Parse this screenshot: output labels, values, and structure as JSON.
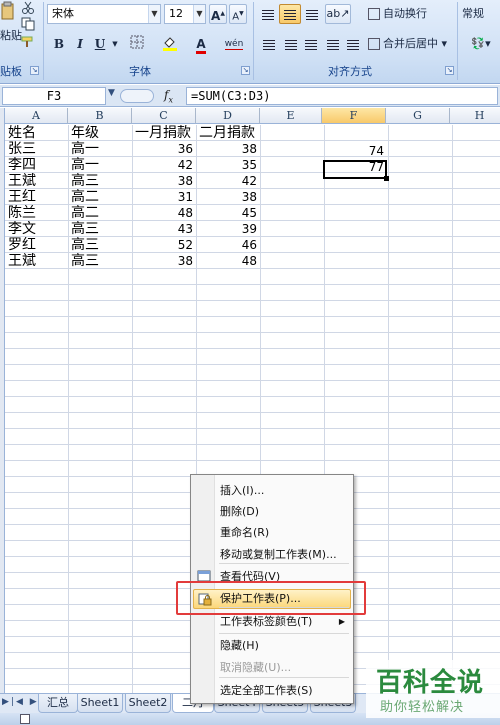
{
  "ribbon": {
    "paste_label": "粘贴",
    "clipboard_label": "贴板",
    "font_name": "宋体",
    "font_size": "12",
    "bold": "B",
    "italic": "I",
    "underline": "U",
    "font_group_label": "字体",
    "wrap_text": "自动换行",
    "merge_center": "合并后居中",
    "align_group_label": "对齐方式",
    "number_format": "常规",
    "grow_font": "A",
    "shrink_font": "A",
    "font_color_letter": "A",
    "phonetic_label": "wén"
  },
  "formula_bar": {
    "name_box": "F3",
    "fx": "f",
    "formula": "=SUM(C3:D3)"
  },
  "columns": [
    "A",
    "B",
    "C",
    "D",
    "E",
    "F",
    "G",
    "H"
  ],
  "table": {
    "headers": [
      "姓名",
      "年级",
      "一月捐款",
      "二月捐款"
    ],
    "rows": [
      [
        "张三",
        "高一",
        "36",
        "38"
      ],
      [
        "李四",
        "高一",
        "42",
        "35"
      ],
      [
        "王斌",
        "高三",
        "38",
        "42"
      ],
      [
        "王红",
        "高二",
        "31",
        "38"
      ],
      [
        "陈兰",
        "高二",
        "48",
        "45"
      ],
      [
        "李文",
        "高三",
        "43",
        "39"
      ],
      [
        "罗红",
        "高三",
        "52",
        "46"
      ],
      [
        "王斌",
        "高三",
        "38",
        "48"
      ]
    ],
    "f_values": [
      "74",
      "77"
    ]
  },
  "context_menu": {
    "items": [
      "插入(I)...",
      "删除(D)",
      "重命名(R)",
      "移动或复制工作表(M)...",
      "查看代码(V)",
      "保护工作表(P)...",
      "工作表标签颜色(T)",
      "隐藏(H)",
      "取消隐藏(U)...",
      "选定全部工作表(S)"
    ]
  },
  "sheet_tabs": [
    "汇总",
    "Sheet1",
    "Sheet2",
    "二月",
    "Sheet4",
    "Sheet5",
    "Sheet3"
  ],
  "watermark": {
    "main": "百科全说",
    "sub": "助你轻松解决"
  },
  "colors": {
    "highlight_box": "#e23b3b",
    "menu_highlight": "#fbd77a",
    "watermark_green": "#2b8a3e"
  }
}
